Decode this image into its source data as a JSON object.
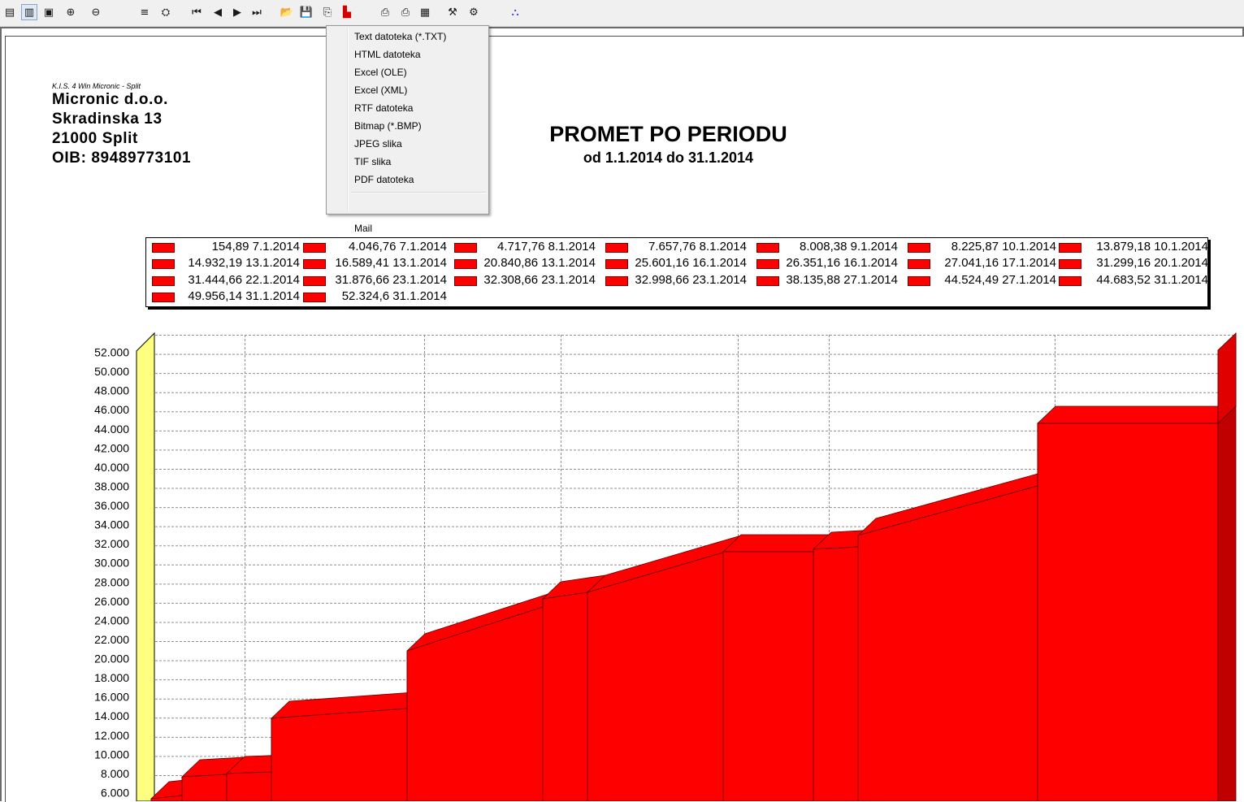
{
  "toolbar": {
    "icons": [
      {
        "name": "page-view-icon",
        "glyph": "▤"
      },
      {
        "name": "two-page-icon",
        "glyph": "▥"
      },
      {
        "name": "full-page-icon",
        "glyph": "▣"
      },
      {
        "name": "zoom-in-icon",
        "glyph": "⊕"
      },
      {
        "name": "zoom-out-icon",
        "glyph": "⊖"
      },
      {
        "name": "tree-icon",
        "glyph": "≡"
      },
      {
        "name": "find-icon",
        "glyph": "⛭"
      },
      {
        "name": "first-page-icon",
        "glyph": "⏮"
      },
      {
        "name": "prev-page-icon",
        "glyph": "◀"
      },
      {
        "name": "next-page-icon",
        "glyph": "▶"
      },
      {
        "name": "last-page-icon",
        "glyph": "⏭"
      },
      {
        "name": "open-icon",
        "glyph": "📂"
      },
      {
        "name": "save-icon",
        "glyph": "💾"
      },
      {
        "name": "export-icon",
        "glyph": "⎘"
      },
      {
        "name": "pdf-icon",
        "glyph": "▙"
      },
      {
        "name": "print-icon",
        "glyph": "⎙"
      },
      {
        "name": "print-setup-icon",
        "glyph": "⎙"
      },
      {
        "name": "page-setup-icon",
        "glyph": "▦"
      },
      {
        "name": "tools-icon",
        "glyph": "⚒"
      },
      {
        "name": "settings-icon",
        "glyph": "⚙"
      },
      {
        "name": "exit-icon",
        "glyph": "⛬"
      }
    ],
    "accent_pdf": "#d40000"
  },
  "company": {
    "software": "K.I.S. 4 Win Micronic - Split",
    "name": "Micronic d.o.o.",
    "street": "Skradinska 13",
    "city": "21000 Split",
    "oib": "OIB: 89489773101"
  },
  "report": {
    "title": "PROMET PO PERIODU",
    "subtitle": "od 1.1.2014 do 31.1.2014"
  },
  "export_menu": {
    "items": [
      "Text datoteka (*.TXT)",
      "HTML datoteka",
      "Excel (OLE)",
      "Excel (XML)",
      "RTF datoteka",
      "Bitmap (*.BMP)",
      "JPEG slika",
      "TIF slika",
      "PDF datoteka"
    ],
    "mail": "Mail"
  },
  "legend": {
    "entries": [
      "154,89 7.1.2014",
      "4.046,76 7.1.2014",
      "4.717,76 8.1.2014",
      "7.657,76 8.1.2014",
      "8.008,38 9.1.2014",
      "8.225,87 10.1.2014",
      "13.879,18 10.1.2014",
      "14.932,19 13.1.2014",
      "16.589,41 13.1.2014",
      "20.840,86 13.1.2014",
      "25.601,16 16.1.2014",
      "26.351,16 16.1.2014",
      "27.041,16 17.1.2014",
      "31.299,16 20.1.2014",
      "31.444,66 22.1.2014",
      "31.876,66 23.1.2014",
      "32.308,66 23.1.2014",
      "32.998,66 23.1.2014",
      "38.135,88 27.1.2014",
      "44.524,49 27.1.2014",
      "44.683,52 31.1.2014",
      "49.956,14 31.1.2014",
      "52.324,6 31.1.2014"
    ]
  },
  "chart_data": {
    "type": "area",
    "title": "PROMET PO PERIODU",
    "subtitle": "od 1.1.2014 do 31.1.2014",
    "y_tick_labels": [
      "6.000",
      "8.000",
      "10.000",
      "12.000",
      "14.000",
      "16.000",
      "18.000",
      "20.000",
      "22.000",
      "24.000",
      "26.000",
      "28.000",
      "30.000",
      "32.000",
      "34.000",
      "36.000",
      "38.000",
      "40.000",
      "42.000",
      "44.000",
      "46.000",
      "48.000",
      "50.000",
      "52.000"
    ],
    "ylim": [
      6000,
      52000
    ],
    "grid": true,
    "legend_placement": "top",
    "series_color": "#ff0000",
    "series": [
      {
        "x": [
          "7.1.2014",
          "7.1.2014",
          "8.1.2014",
          "8.1.2014",
          "9.1.2014",
          "10.1.2014",
          "10.1.2014",
          "13.1.2014",
          "13.1.2014",
          "13.1.2014",
          "16.1.2014",
          "16.1.2014",
          "17.1.2014",
          "20.1.2014",
          "22.1.2014",
          "23.1.2014",
          "23.1.2014",
          "23.1.2014",
          "27.1.2014",
          "27.1.2014",
          "31.1.2014",
          "31.1.2014",
          "31.1.2014"
        ],
        "values": [
          154.89,
          4046.76,
          4717.76,
          7657.76,
          8008.38,
          8225.87,
          13879.18,
          14932.19,
          16589.41,
          20840.86,
          25601.16,
          26351.16,
          27041.16,
          31299.16,
          31444.66,
          31876.66,
          32308.66,
          32998.66,
          38135.88,
          44524.49,
          44683.52,
          49956.14,
          52324.6
        ]
      }
    ]
  }
}
